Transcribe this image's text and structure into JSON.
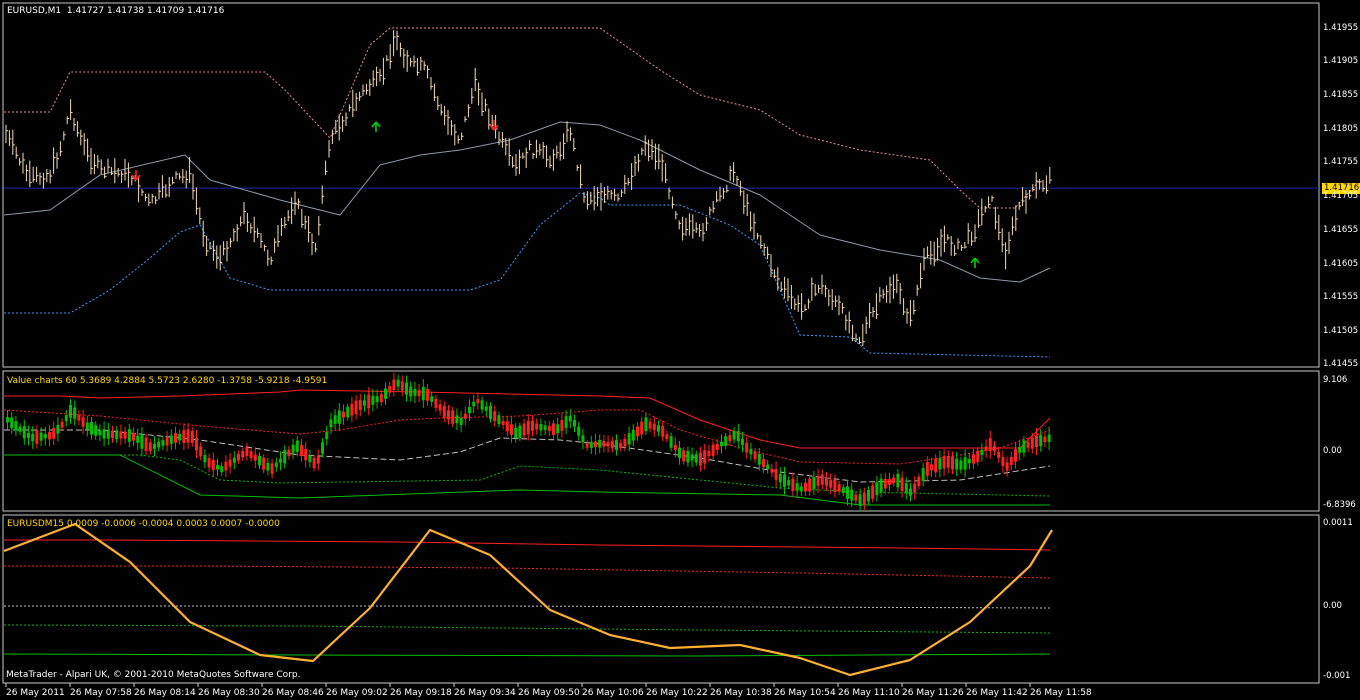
{
  "header": {
    "symbol": "EURUSD,M1",
    "ohlc": "1.41727 1.41738 1.41709 1.41716",
    "current_price": "1.41716"
  },
  "price_panel": {
    "ylabels": [
      "1.41955",
      "1.41905",
      "1.41855",
      "1.41805",
      "1.41755",
      "1.41705",
      "1.41655",
      "1.41605",
      "1.41555",
      "1.41505",
      "1.41455"
    ],
    "price_line": 1.41716
  },
  "value_panel": {
    "label": "Value charts 60 5.3689 4.2884 5.5723 2.6280 -1.3758 -5.9218 -4.9591",
    "ylabels": [
      "9.106",
      "0.00",
      "-6.8396"
    ]
  },
  "eurusdm_panel": {
    "label": "EURUSDM15 0.0009 -0.0006 -0.0004 0.0003 0.0007 -0.0000",
    "ylabels": [
      "0.0011",
      "0.00",
      "-0.001"
    ]
  },
  "time_axis": {
    "labels": [
      "26 May 2011",
      "26 May 07:58",
      "26 May 08:14",
      "26 May 08:30",
      "26 May 08:46",
      "26 May 09:02",
      "26 May 09:18",
      "26 May 09:34",
      "26 May 09:50",
      "26 May 10:06",
      "26 May 10:22",
      "26 May 10:38",
      "26 May 10:54",
      "26 May 11:10",
      "26 May 11:26",
      "26 May 11:42",
      "26 May 11:58"
    ]
  },
  "footer": {
    "copyright": "MetaTrader - Alpari UK, © 2001-2010 MetaQuotes Software Corp."
  },
  "colors": {
    "background": "#000000",
    "bars": "#f5deb3",
    "grid_border": "#c8c8c8",
    "upper_channel": "#e89090",
    "lower_channel": "#3aa0ff",
    "middle_line": "#8a9aa8",
    "price_line": "#1e2aa8",
    "bull_candle": "#00c000",
    "bear_candle": "#ff2020",
    "oscillator": "#ffb030",
    "red_band": "#ff2020",
    "green_band": "#00c000",
    "price_tag": "#ffd700",
    "arrow_up": "#00d000",
    "arrow_down": "#ff2020"
  }
}
